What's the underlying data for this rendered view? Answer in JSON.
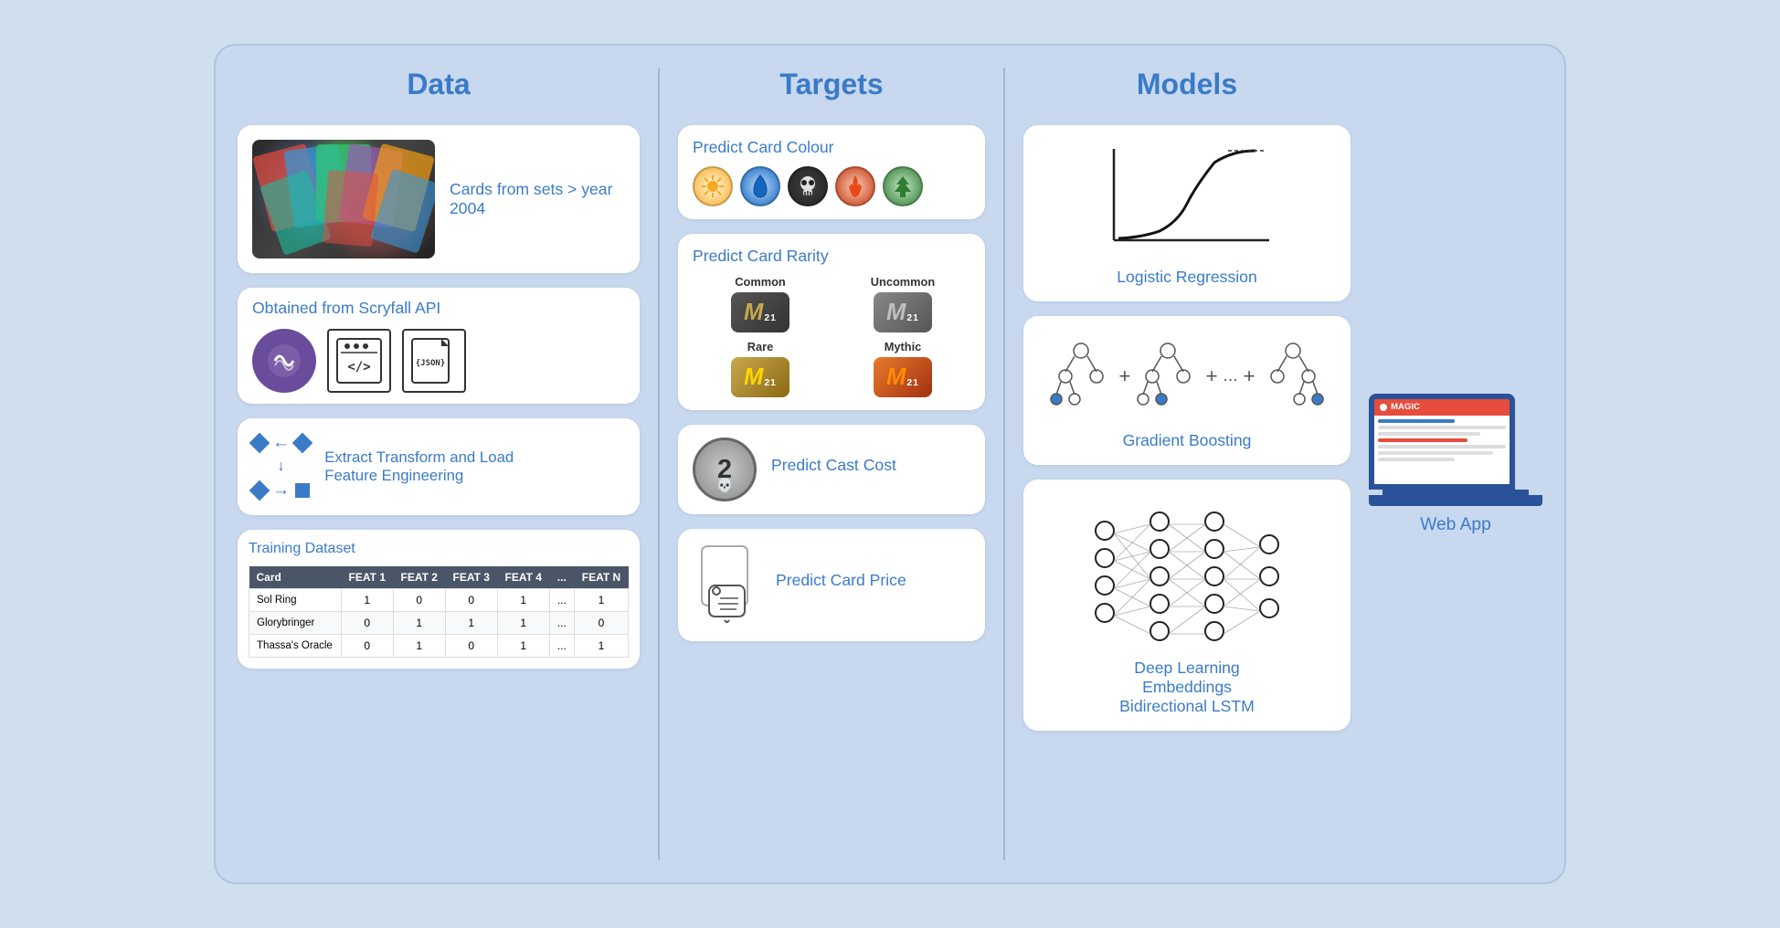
{
  "columns": {
    "data": {
      "header": "Data",
      "cards": {
        "image": {
          "text": "Cards from sets > year 2004"
        },
        "api": {
          "title": "Obtained from Scryfall API",
          "icons": [
            "</>",
            "{JSON}"
          ]
        },
        "etl": {
          "line1": "Extract Transform and Load",
          "line2": "Feature Engineering"
        },
        "table": {
          "title": "Training Dataset",
          "headers": [
            "Card",
            "FEAT 1",
            "FEAT 2",
            "FEAT 3",
            "FEAT 4",
            "...",
            "FEAT N"
          ],
          "rows": [
            [
              "Sol Ring",
              "1",
              "0",
              "0",
              "1",
              "...",
              "1"
            ],
            [
              "Glorybringer",
              "0",
              "1",
              "1",
              "1",
              "...",
              "0"
            ],
            [
              "Thassa's Oracle",
              "0",
              "1",
              "0",
              "1",
              "...",
              "1"
            ]
          ]
        }
      }
    },
    "targets": {
      "header": "Targets",
      "cards": {
        "colour": {
          "title": "Predict Card Colour",
          "symbols": [
            "☀",
            "💧",
            "💀",
            "🔥",
            "🌲"
          ]
        },
        "rarity": {
          "title": "Predict Card Rarity",
          "items": [
            {
              "label": "Common",
              "class": "rarity-common"
            },
            {
              "label": "Uncommon",
              "class": "rarity-uncommon"
            },
            {
              "label": "Rare",
              "class": "rarity-rare"
            },
            {
              "label": "Mythic",
              "class": "rarity-mythic"
            }
          ]
        },
        "castcost": {
          "title": "Predict Cast Cost"
        },
        "price": {
          "title": "Predict Card Price"
        }
      }
    },
    "models": {
      "header": "Models",
      "cards": {
        "logistic": {
          "title": "Logistic Regression"
        },
        "gradient": {
          "title": "Gradient Boosting"
        },
        "deep": {
          "title": "Deep Learning\nEmbeddings\nBidirectional LSTM"
        }
      }
    },
    "webapp": {
      "label": "Web App"
    }
  }
}
